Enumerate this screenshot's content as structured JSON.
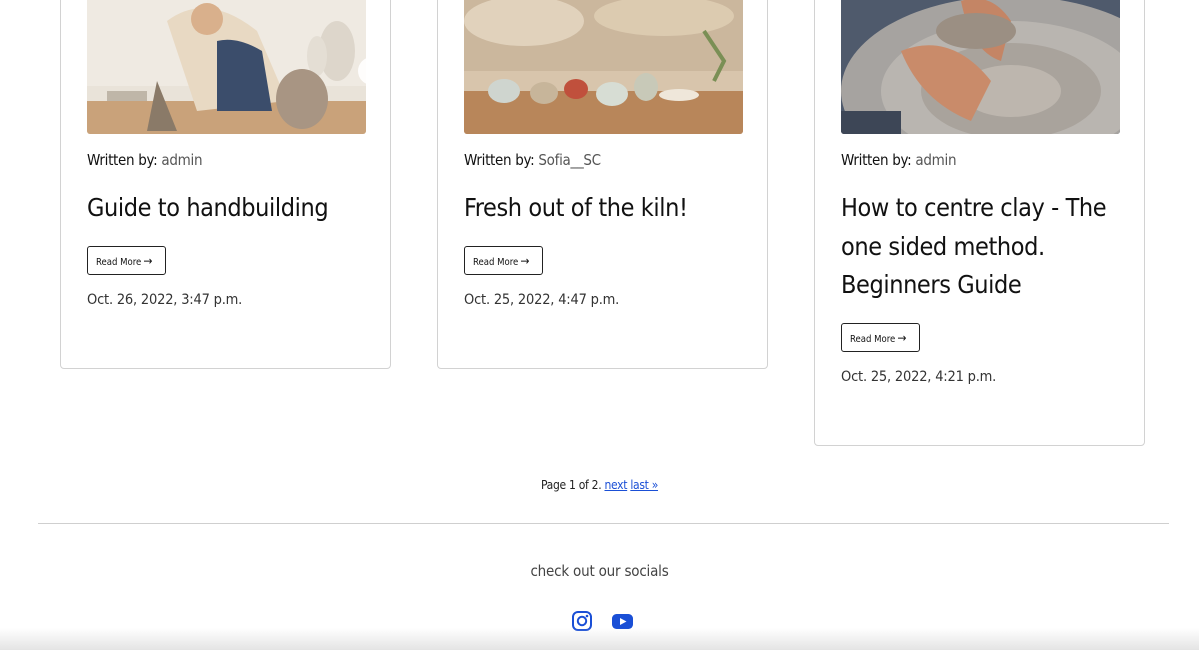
{
  "posts": [
    {
      "written_by_label": "Written by:",
      "author": "admin",
      "title": "Guide to handbuilding",
      "read_more": "Read More",
      "date": "Oct. 26, 2022, 3:47 p.m."
    },
    {
      "written_by_label": "Written by:",
      "author": "Sofia__SC",
      "title": "Fresh out of the kiln!",
      "read_more": "Read More",
      "date": "Oct. 25, 2022, 4:47 p.m."
    },
    {
      "written_by_label": "Written by:",
      "author": "admin",
      "title": "How to centre clay - The one sided method. Beginners Guide",
      "read_more": "Read More",
      "date": "Oct. 25, 2022, 4:21 p.m."
    }
  ],
  "pagination": {
    "text": "Page 1 of 2.",
    "next": "next",
    "last": "last »"
  },
  "footer": {
    "socials_label": "check out our socials",
    "icons": [
      "instagram-icon",
      "youtube-icon"
    ],
    "icon_color": "#1a4fd6"
  }
}
